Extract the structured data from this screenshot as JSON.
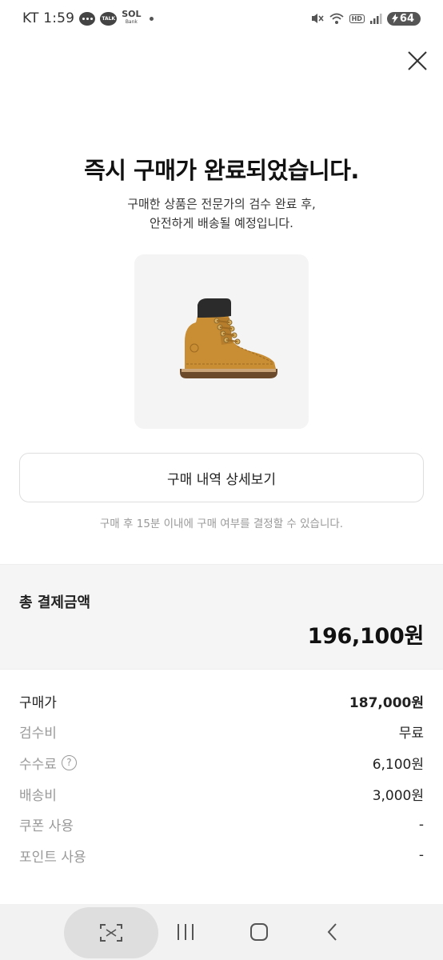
{
  "status_bar": {
    "carrier_time": "KT 1:59",
    "talk_label": "TALK",
    "sol_label": "SOL",
    "sol_sub": "Bank",
    "hd_label": "HD",
    "battery_level": "64",
    "icons": [
      "chat-icon",
      "kakaotalk-icon",
      "sol-bank-icon",
      "mute-icon",
      "wifi-icon",
      "signal-icon",
      "battery-icon"
    ]
  },
  "header": {
    "title": "즉시 구매가 완료되었습니다.",
    "subtitle_line1": "구매한 상품은 전문가의 검수 완료 후,",
    "subtitle_line2": "안전하게 배송될 예정입니다."
  },
  "actions": {
    "detail_button": "구매 내역 상세보기",
    "notice": "구매 후 15분 이내에 구매 여부를 결정할 수 있습니다."
  },
  "total": {
    "label": "총 결제금액",
    "value": "196,100원"
  },
  "breakdown": [
    {
      "label": "구매가",
      "value": "187,000원"
    },
    {
      "label": "검수비",
      "value": "무료"
    },
    {
      "label": "수수료",
      "value": "6,100원"
    },
    {
      "label": "배송비",
      "value": "3,000원"
    },
    {
      "label": "쿠폰 사용",
      "value": "-"
    },
    {
      "label": "포인트 사용",
      "value": "-"
    }
  ],
  "colors": {
    "accent_text": "#111111",
    "muted_text": "#999999",
    "panel_bg": "#f5f5f5",
    "boot": "#c98d34"
  }
}
